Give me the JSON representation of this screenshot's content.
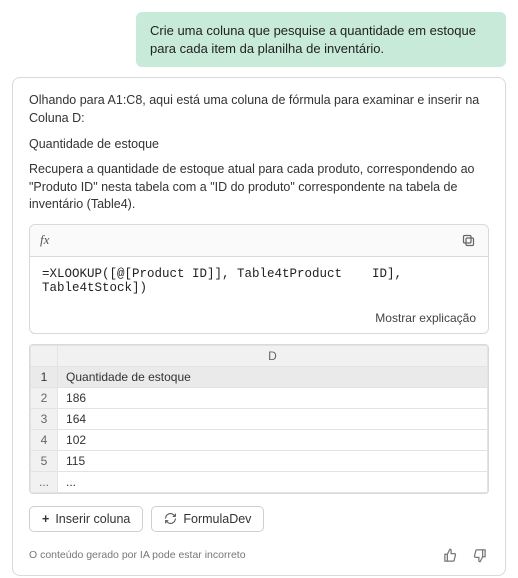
{
  "user_message": "Crie uma coluna que pesquise a quantidade em estoque para cada item da planilha de inventário.",
  "assistant": {
    "intro": "Olhando para A1:C8, aqui está uma coluna de fórmula para examinar e inserir na Coluna D:",
    "column_title": "Quantidade de estoque",
    "description": "Recupera a quantidade de estoque atual para cada produto, correspondendo ao \"Produto ID\" nesta tabela com a \"ID do produto\" correspondente na tabela de inventário (Table4).",
    "formula_label": "fx",
    "formula": "=XLOOKUP([@[Product ID]], Table4tProduct    ID], Table4tStock])",
    "show_explanation": "Mostrar explicação",
    "preview": {
      "column_letter": "D",
      "header": "Quantidade de estoque",
      "rows": [
        {
          "n": "1",
          "v": "Quantidade de estoque"
        },
        {
          "n": "2",
          "v": "186"
        },
        {
          "n": "3",
          "v": "164"
        },
        {
          "n": "4",
          "v": "102"
        },
        {
          "n": "5",
          "v": "115"
        },
        {
          "n": "...",
          "v": "..."
        }
      ]
    },
    "actions": {
      "insert": "Inserir coluna",
      "formula_dev": "FormulaDev"
    },
    "disclaimer": "O conteúdo gerado por IA pode estar incorreto"
  }
}
